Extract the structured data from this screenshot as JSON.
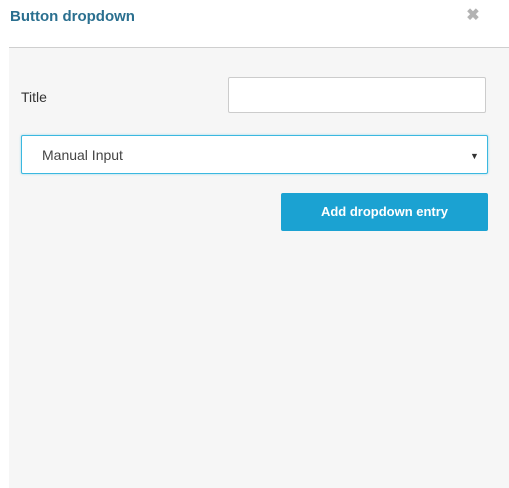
{
  "dialog": {
    "title": "Button dropdown",
    "close_glyph": "✖",
    "close_icon": "close-icon"
  },
  "form": {
    "title_label": "Title",
    "title_value": "",
    "title_placeholder": "",
    "source_select": {
      "selected": "Manual Input",
      "arrow_glyph": "▼"
    },
    "add_button_label": "Add dropdown entry"
  },
  "colors": {
    "title": "#2a6f8f",
    "button": "#1ba2d2",
    "select_focus": "#3bb8e0",
    "panel_bg": "#f6f6f6"
  }
}
